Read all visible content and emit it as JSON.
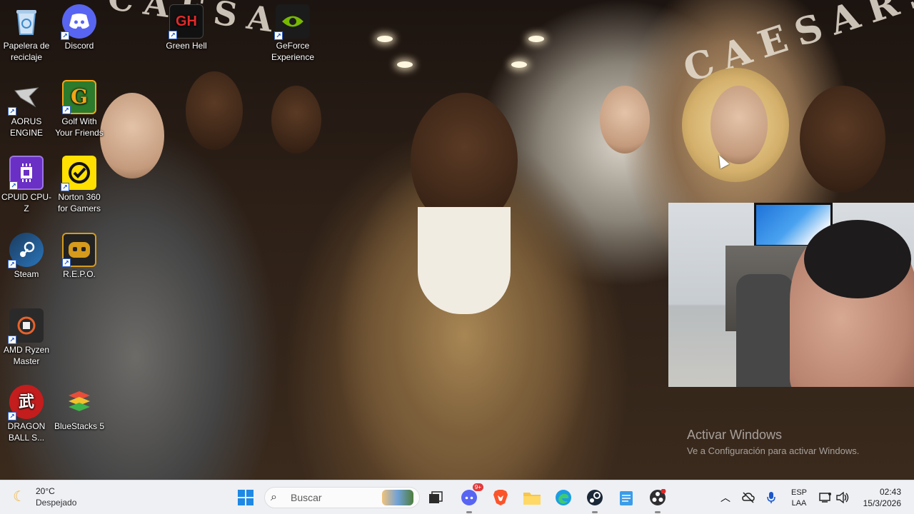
{
  "wallpaper": {
    "sign_left": "CAESAR",
    "sign_right": "CAESARS"
  },
  "desktop_icons": [
    {
      "label": "Papelera de reciclaje",
      "icon": "recycle-bin-icon",
      "color": "#5ba6e0"
    },
    {
      "label": "Discord",
      "icon": "discord-icon",
      "color": "#5865f2"
    },
    {
      "label": "Green Hell",
      "icon": "green-hell-icon",
      "color": "#1a1a1a"
    },
    {
      "label": "GeForce Experience",
      "icon": "geforce-icon",
      "color": "#76b900"
    },
    {
      "label": "AORUS ENGINE",
      "icon": "aorus-icon",
      "color": "#2b2b2b"
    },
    {
      "label": "Golf With Your Friends",
      "icon": "golf-icon",
      "color": "#f2a516"
    },
    {
      "label": "CPUID CPU-Z",
      "icon": "cpuz-icon",
      "color": "#6a2fc4"
    },
    {
      "label": "Norton 360 for Gamers",
      "icon": "norton-icon",
      "color": "#ffe000"
    },
    {
      "label": "Steam",
      "icon": "steam-icon",
      "color": "#1b2838"
    },
    {
      "label": "R.E.P.O.",
      "icon": "repo-icon",
      "color": "#d69b1c"
    },
    {
      "label": "AMD Ryzen Master",
      "icon": "ryzen-icon",
      "color": "#333333"
    },
    {
      "label": "DRAGON BALL S...",
      "icon": "dragonball-icon",
      "color": "#c41d1d"
    },
    {
      "label": "BlueStacks 5",
      "icon": "bluestacks-icon",
      "color": "#3fb24a"
    }
  ],
  "activation": {
    "title": "Activar Windows",
    "subtitle": "Ve a Configuración para activar Windows."
  },
  "taskbar": {
    "weather": {
      "temp": "20°C",
      "condition": "Despejado"
    },
    "search_placeholder": "Buscar",
    "discord_badge": "9+",
    "language": {
      "line1": "ESP",
      "line2": "LAA"
    },
    "clock": {
      "time": "02:43",
      "date": "15/3/2026"
    }
  }
}
